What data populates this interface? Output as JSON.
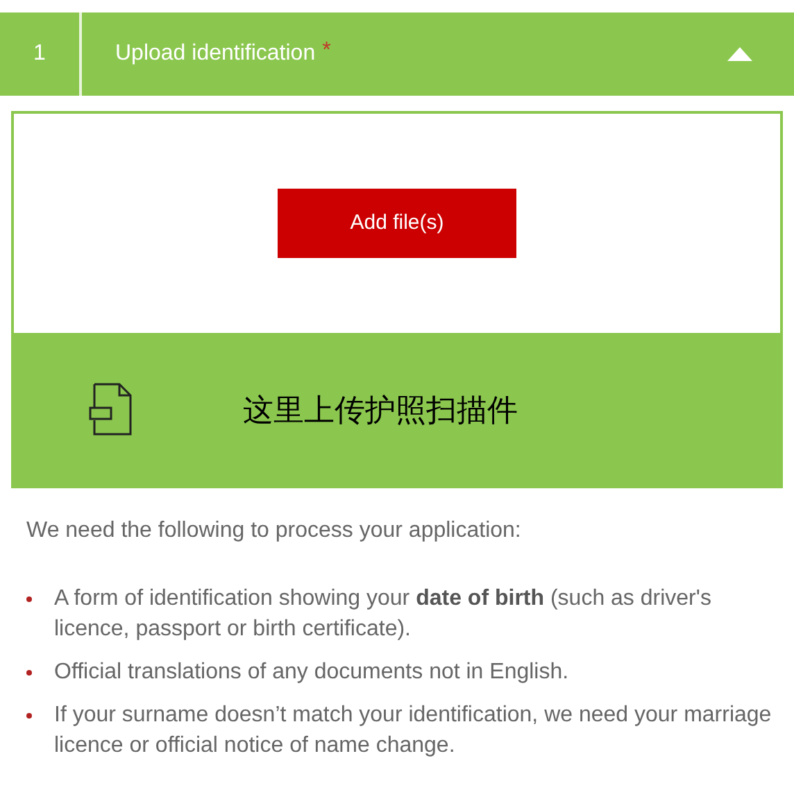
{
  "step": {
    "number": "1",
    "title": "Upload identification",
    "required_mark": "*",
    "expanded": true
  },
  "upload": {
    "button": "Add file(s)",
    "dropzone_text": "这里上传护照扫描件"
  },
  "intro": "We need the following to process your application:",
  "requirements": [
    "A form of identification showing your **date of birth** (such as driver's licence, passport or birth certificate).",
    "Official translations of any documents not in English.",
    "If your surname doesn’t match your identification, we need your marriage licence or official notice of name change."
  ]
}
